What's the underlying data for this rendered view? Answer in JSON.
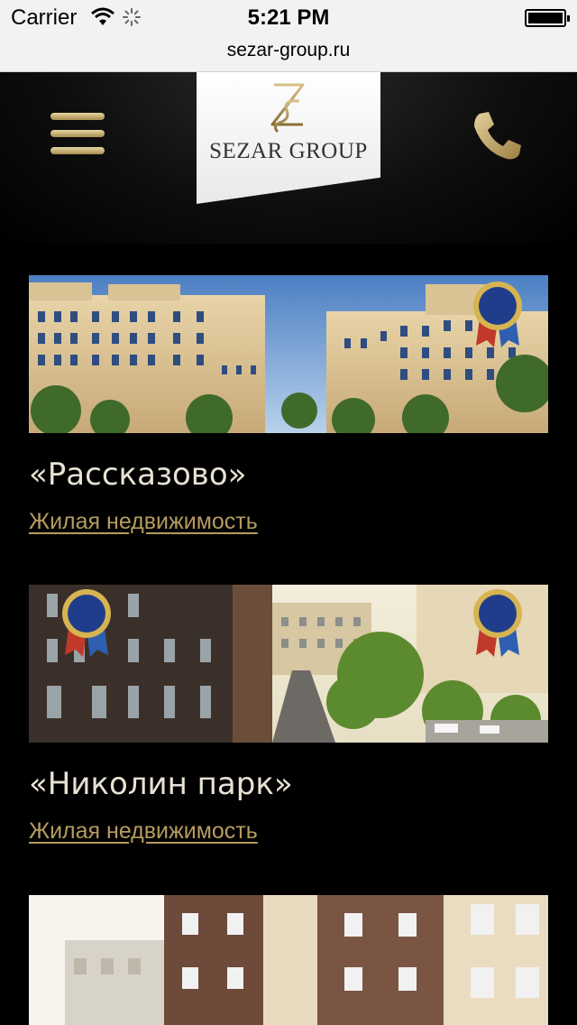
{
  "status_bar": {
    "carrier": "Carrier",
    "time": "5:21 PM"
  },
  "browser": {
    "url": "sezar-group.ru"
  },
  "header": {
    "logo_text": "SEZAR GROUP",
    "logo_monogram": "ZS",
    "menu_icon": "hamburger-menu-icon",
    "phone_icon": "phone-icon",
    "accent_color": "#b59c5f"
  },
  "projects": [
    {
      "title": "«Рассказово»",
      "category": "Жилая недвижимость"
    },
    {
      "title": "«Николин парк»",
      "category": "Жилая недвижимость"
    },
    {
      "title": "",
      "category": ""
    }
  ]
}
